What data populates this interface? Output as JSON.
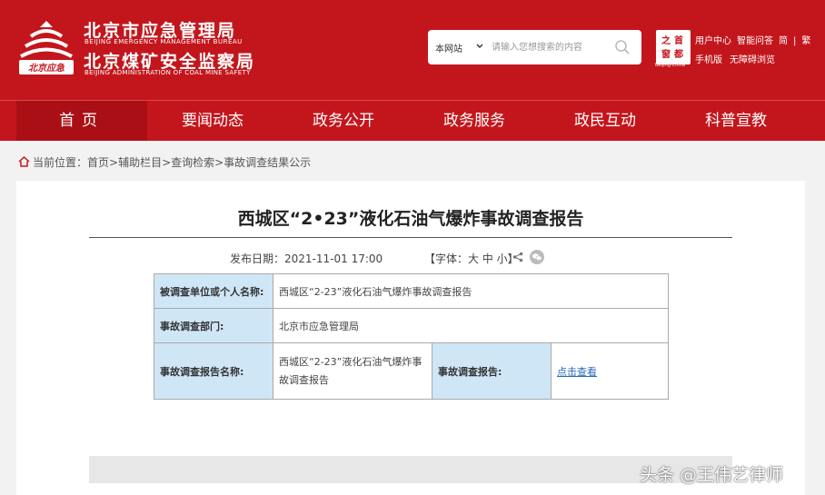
{
  "header": {
    "org_name_cn": "北京市应急管理局",
    "org_name_en": "BEIJING EMERGENCY MANAGEMENT BUREAU",
    "org2_name_cn": "北京煤矿安全监察局",
    "org2_name_en": "BEIJING ADMINISTRATION OF COAL MINE SAFETY",
    "logo_caption": "北京应急",
    "search_scope": "本网站",
    "search_placeholder": "请输入您想搜索的内容",
    "capital_chars": [
      "首",
      "都",
      "之",
      "窗"
    ],
    "capital_caption": "Beijing·China",
    "links_row1": [
      "用户中心",
      "智能问答",
      "简",
      "|",
      "繁"
    ],
    "links_row2": [
      "手机版",
      "无障碍浏览"
    ],
    "brand_color": "#c3161c"
  },
  "nav": {
    "items": [
      "首页",
      "要闻动态",
      "政务公开",
      "政务服务",
      "政民互动",
      "科普宣教"
    ]
  },
  "breadcrumb": {
    "label": "当前位置：",
    "path": "首页>辅助栏目>查询检索>事故调查结果公示"
  },
  "article": {
    "title": "西城区“2•23”液化石油气爆炸事故调查报告",
    "publish_label": "发布日期：",
    "publish_date": "2021-11-01 17:00",
    "font_size_label": "【字体：大 中 小】"
  },
  "table": {
    "row1_key": "被调查单位或个人名称:",
    "row1_value": "西城区“2-23”液化石油气爆炸事故调查报告",
    "row2_key": "事故调查部门:",
    "row2_value": "北京市应急管理局",
    "row3_key": "事故调查报告名称:",
    "row3_value": "西城区“2-23”液化石油气爆炸事故调查报告",
    "row3_key2": "事故调查报告:",
    "row3_link": "点击查看"
  },
  "watermark": "头条 @王伟艺律师"
}
